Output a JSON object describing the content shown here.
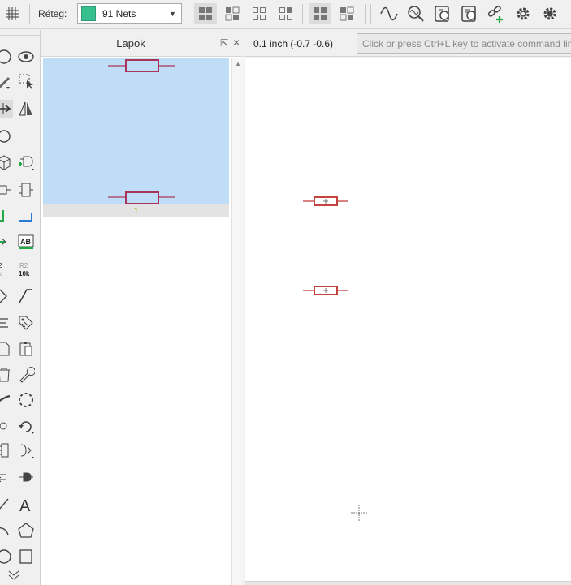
{
  "toolbar": {
    "grid_icon": "grid-icon",
    "layer_label": "Réteg:",
    "layer_value": "91 Nets",
    "layer_color": "#36c08f",
    "view_icons": [
      "view-mode-1-icon",
      "view-mode-2-icon",
      "view-mode-3-icon",
      "view-mode-4-icon",
      "view-mode-5-icon",
      "view-mode-6-icon"
    ],
    "tool_icons": [
      "waveform-icon",
      "probe-icon",
      "schematic-check-icon",
      "schematic-export-icon",
      "link-add-icon",
      "settings-icon",
      "settings-alt-icon"
    ]
  },
  "pages_panel": {
    "title": "Lapok",
    "undock_glyph": "⇱",
    "close_glyph": "×",
    "page_number": "1"
  },
  "canvas": {
    "coordinate_readout": "0.1 inch (-0.7 -0.6)",
    "command_placeholder": "Click or press Ctrl+L key to activate command line"
  },
  "tools": [
    "circle-icon",
    "eye-icon",
    "pen-icon",
    "select-rect-icon",
    "move-icon",
    "mirror-icon",
    "ellipse-icon",
    "cube-icon",
    "add-pin-icon",
    "pin-icon",
    "component-icon",
    "wire-green-icon",
    "wire-blue-icon",
    "net-arrow-icon",
    "text-ab-icon",
    "label-r2-icon",
    "label-r2-10k-icon",
    "bus-icon",
    "line-diagonal-icon",
    "list-icon",
    "tag-icon",
    "doc-icon",
    "clipboard-icon",
    "trash-icon",
    "wrench-icon",
    "brush-icon",
    "dashed-circle-icon",
    "probe-icon-2",
    "rotate-icon",
    "pin-grid-icon",
    "connector-icon",
    "arrow-in-icon",
    "connector-alt-icon",
    "line-icon",
    "text-a-icon",
    "arc-icon",
    "pentagon-icon",
    "circle-outline-icon",
    "rectangle-icon"
  ]
}
